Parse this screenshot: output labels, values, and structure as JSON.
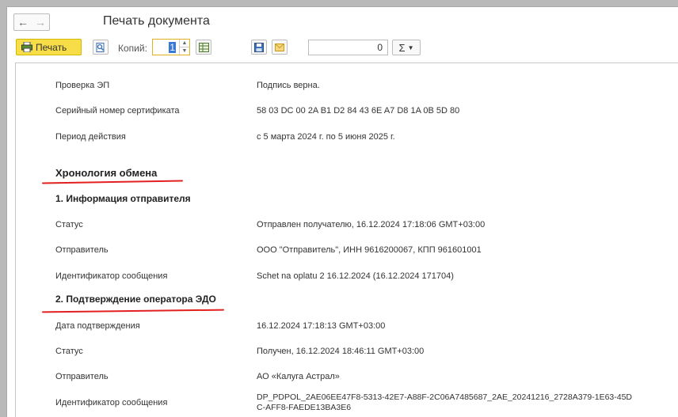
{
  "window": {
    "title": "Печать документа"
  },
  "toolbar": {
    "print_label": "Печать",
    "copies_label": "Копий:",
    "copies_value": "1",
    "sum_value": "0",
    "sum_symbol": "Σ"
  },
  "signature": [
    {
      "label": "Проверка ЭП",
      "value": "Подпись верна."
    },
    {
      "label": "Серийный номер сертификата",
      "value": "58 03 DC 00 2A B1 D2 84 43 6E A7 D8 1A 0B 5D 80"
    },
    {
      "label": "Период действия",
      "value": "с 5 марта 2024 г. по 5 июня 2025 г."
    }
  ],
  "chronology": {
    "heading": "Хронология обмена",
    "section1": {
      "heading": "1. Информация отправителя",
      "rows": [
        {
          "label": "Статус",
          "value": "Отправлен получателю, 16.12.2024 17:18:06 GMT+03:00"
        },
        {
          "label": "Отправитель",
          "value": "ООО \"Отправитель\", ИНН 9616200067, КПП 961601001"
        },
        {
          "label": "Идентификатор сообщения",
          "value": "Schet na oplatu 2 16.12.2024 (16.12.2024 171704)"
        }
      ]
    },
    "section2": {
      "heading": "2. Подтверждение оператора ЭДО",
      "rows": [
        {
          "label": "Дата подтверждения",
          "value": "16.12.2024 17:18:13 GMT+03:00"
        },
        {
          "label": "Статус",
          "value": "Получен, 16.12.2024 18:46:11 GMT+03:00"
        },
        {
          "label": "Отправитель",
          "value": "АО «Калуга Астрал»"
        },
        {
          "label": "Идентификатор сообщения",
          "value": "DP_PDPOL_2AE06EE47F8-5313-42E7-A88F-2C06A7485687_2AE_20241216_2728A379-1E63-45D",
          "value2": "C-AFF8-FAEDE13BA3E6"
        }
      ]
    }
  },
  "colors": {
    "accent": "#f7dd47",
    "underline": "#e32020"
  }
}
